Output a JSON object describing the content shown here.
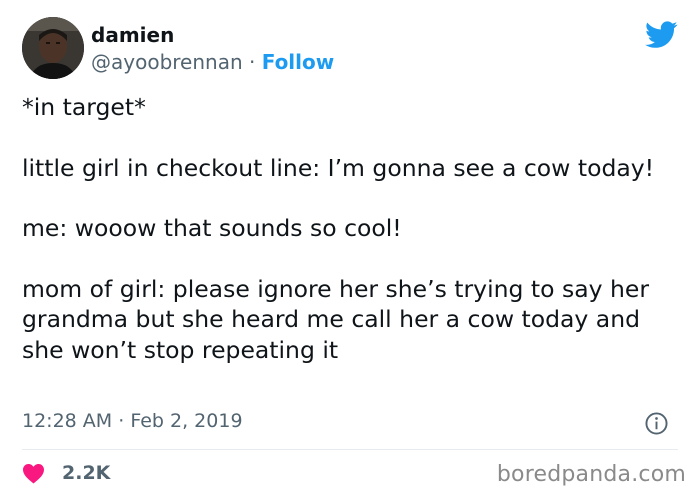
{
  "author": {
    "display_name": "damien",
    "handle": "@ayoobrennan",
    "separator": "·",
    "follow_label": "Follow"
  },
  "tweet": {
    "paragraphs": [
      "*in target*",
      "little girl in checkout line: I’m gonna see a cow today!",
      "me: wooow that sounds so cool!",
      "mom of girl: please ignore her she’s trying to say her grandma but she heard me call her a cow today and she won’t stop repeating it"
    ],
    "time": "12:28 AM",
    "time_separator": "·",
    "date": "Feb 2, 2019"
  },
  "engagement": {
    "likes": "2.2K"
  },
  "watermark": "boredpanda.com",
  "colors": {
    "accent": "#1d9bf0",
    "heart": "#f91880",
    "muted_text": "#536471"
  },
  "icons": {
    "brand": "twitter-bird-icon",
    "info": "info-icon",
    "like": "heart-icon"
  }
}
